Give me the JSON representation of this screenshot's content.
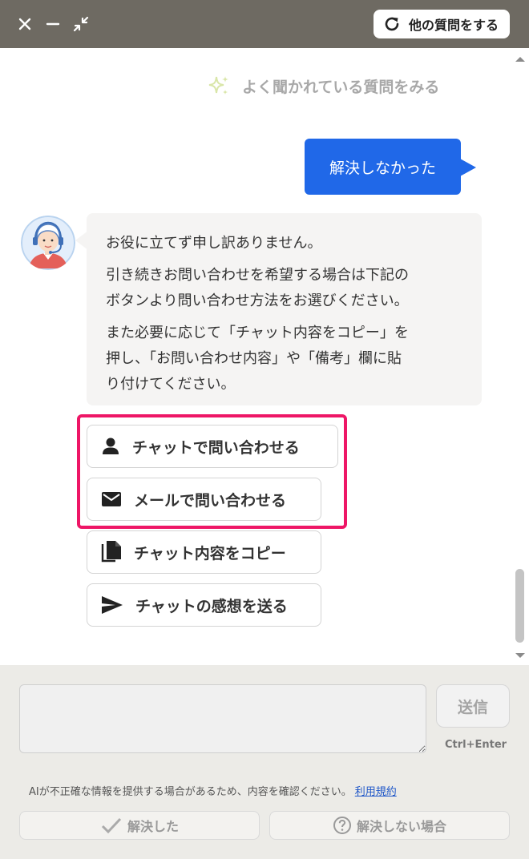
{
  "titlebar": {
    "close_icon": "close-icon",
    "minimize_icon": "minimize-icon",
    "collapse_icon": "collapse-icon",
    "other_question_label": "他の質問をする"
  },
  "chat": {
    "faq_link": "よく聞かれている質問をみる",
    "user_message": "解決しなかった",
    "bot_message": {
      "p1": "お役に立てず申し訳ありません。",
      "p2_line1": "引き続きお問い合わせを希望する場合は下記の",
      "p2_line2": "ボタンより問い合わせ方法をお選びください。",
      "p3_line1": "また必要に応じて「チャット内容をコピー」を",
      "p3_line2": "押し、「お問い合わせ内容」や「備考」欄に貼",
      "p3_line3": "り付けてください。"
    },
    "actions": [
      {
        "label": "チャットで問い合わせる",
        "icon": "person-icon"
      },
      {
        "label": "メールで問い合わせる",
        "icon": "mail-icon"
      },
      {
        "label": "チャット内容をコピー",
        "icon": "copy-icon"
      },
      {
        "label": "チャットの感想を送る",
        "icon": "send-icon"
      }
    ]
  },
  "footer": {
    "input_placeholder": "",
    "send_label": "送信",
    "send_hint": "Ctrl+Enter",
    "disclaimer": "AIが不正確な情報を提供する場合があるため、内容を確認ください。",
    "terms_link": "利用規約",
    "resolved_label": "解決した",
    "not_resolved_label": "解決しない場合"
  },
  "colors": {
    "titlebar": "#6e6a62",
    "user_bubble": "#2068e8",
    "highlight": "#ee1666",
    "link": "#1f57c8"
  }
}
